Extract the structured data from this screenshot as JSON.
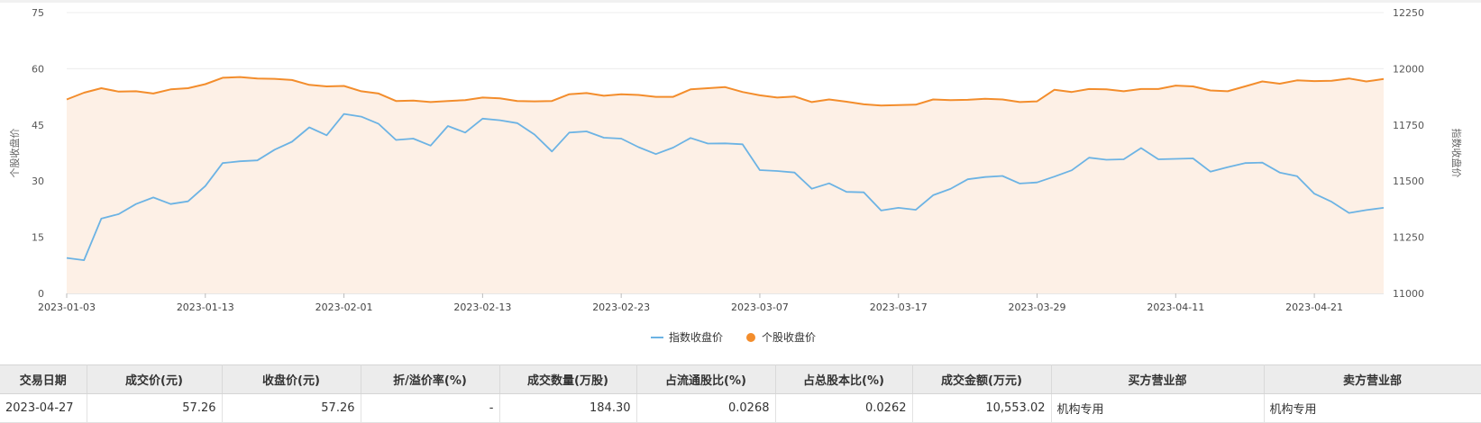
{
  "chart_data": {
    "type": "line",
    "x": [
      "2023-01-03",
      "2023-01-04",
      "2023-01-05",
      "2023-01-06",
      "2023-01-09",
      "2023-01-10",
      "2023-01-11",
      "2023-01-12",
      "2023-01-13",
      "2023-01-16",
      "2023-01-17",
      "2023-01-18",
      "2023-01-19",
      "2023-01-20",
      "2023-01-30",
      "2023-01-31",
      "2023-02-01",
      "2023-02-02",
      "2023-02-03",
      "2023-02-06",
      "2023-02-07",
      "2023-02-08",
      "2023-02-09",
      "2023-02-10",
      "2023-02-13",
      "2023-02-14",
      "2023-02-15",
      "2023-02-16",
      "2023-02-17",
      "2023-02-20",
      "2023-02-21",
      "2023-02-22",
      "2023-02-23",
      "2023-02-24",
      "2023-02-27",
      "2023-02-28",
      "2023-03-01",
      "2023-03-02",
      "2023-03-03",
      "2023-03-06",
      "2023-03-07",
      "2023-03-08",
      "2023-03-09",
      "2023-03-10",
      "2023-03-13",
      "2023-03-14",
      "2023-03-15",
      "2023-03-16",
      "2023-03-17",
      "2023-03-20",
      "2023-03-21",
      "2023-03-22",
      "2023-03-23",
      "2023-03-24",
      "2023-03-27",
      "2023-03-28",
      "2023-03-29",
      "2023-03-30",
      "2023-03-31",
      "2023-04-03",
      "2023-04-04",
      "2023-04-06",
      "2023-04-07",
      "2023-04-10",
      "2023-04-11",
      "2023-04-12",
      "2023-04-13",
      "2023-04-14",
      "2023-04-17",
      "2023-04-18",
      "2023-04-19",
      "2023-04-20",
      "2023-04-21",
      "2023-04-24",
      "2023-04-25",
      "2023-04-26",
      "2023-04-27"
    ],
    "x_ticks": [
      "2023-01-03",
      "2023-01-13",
      "2023-02-01",
      "2023-02-13",
      "2023-02-23",
      "2023-03-07",
      "2023-03-17",
      "2023-03-29",
      "2023-04-11",
      "2023-04-21"
    ],
    "series": [
      {
        "name": "指数收盘价",
        "axis": "right",
        "color": "#6cb3e4",
        "values": [
          11158,
          11148,
          11333,
          11353,
          11398,
          11427,
          11398,
          11410,
          11478,
          11580,
          11588,
          11592,
          11640,
          11675,
          11739,
          11704,
          11799,
          11787,
          11755,
          11683,
          11689,
          11658,
          11745,
          11716,
          11778,
          11771,
          11758,
          11707,
          11632,
          11716,
          11721,
          11693,
          11689,
          11651,
          11620,
          11649,
          11692,
          11667,
          11668,
          11664,
          11549,
          11545,
          11538,
          11466,
          11490,
          11452,
          11450,
          11369,
          11381,
          11372,
          11437,
          11465,
          11508,
          11518,
          11523,
          11489,
          11494,
          11520,
          11548,
          11604,
          11595,
          11597,
          11647,
          11597,
          11599,
          11601,
          11542,
          11562,
          11580,
          11582,
          11538,
          11522,
          11444,
          11408,
          11358,
          11371,
          11381
        ]
      },
      {
        "name": "个股收盘价",
        "axis": "left",
        "color": "#f38d2c",
        "values": [
          51.8,
          53.6,
          54.8,
          53.9,
          54.0,
          53.4,
          54.5,
          54.8,
          55.9,
          57.6,
          57.8,
          57.4,
          57.3,
          57.0,
          55.7,
          55.3,
          55.4,
          54.0,
          53.4,
          51.4,
          51.5,
          51.1,
          51.4,
          51.6,
          52.3,
          52.1,
          51.4,
          51.3,
          51.4,
          53.2,
          53.5,
          52.8,
          53.2,
          53.0,
          52.5,
          52.5,
          54.5,
          54.8,
          55.1,
          53.8,
          52.9,
          52.3,
          52.6,
          51.1,
          51.8,
          51.2,
          50.5,
          50.2,
          50.3,
          50.4,
          51.8,
          51.6,
          51.7,
          52.0,
          51.8,
          51.1,
          51.3,
          54.4,
          53.8,
          54.6,
          54.5,
          54.0,
          54.6,
          54.6,
          55.5,
          55.3,
          54.2,
          54.0,
          55.3,
          56.6,
          56.0,
          56.9,
          56.7,
          56.8,
          57.4,
          56.6,
          57.26
        ]
      }
    ],
    "y_left": {
      "label": "个股收盘价",
      "ticks": [
        0,
        15,
        30,
        45,
        60,
        75
      ],
      "min": 0,
      "max": 75
    },
    "y_right": {
      "label": "指数收盘价",
      "ticks": [
        11000,
        11250,
        11500,
        11750,
        12000,
        12250
      ],
      "min": 11000,
      "max": 12250
    },
    "grid": true,
    "area_fill": {
      "series": "个股收盘价",
      "color": "#fdf0e6"
    },
    "legend_position": "bottom-center"
  },
  "table": {
    "headers": [
      "交易日期",
      "成交价(元)",
      "收盘价(元)",
      "折/溢价率(%)",
      "成交数量(万股)",
      "占流通股比(%)",
      "占总股本比(%)",
      "成交金额(万元)",
      "买方营业部",
      "卖方营业部"
    ],
    "rows": [
      {
        "date": "2023-04-27",
        "deal_price": "57.26",
        "close_price": "57.26",
        "premium": "-",
        "volume": "184.30",
        "float_ratio": "0.0268",
        "total_ratio": "0.0262",
        "amount": "10,553.02",
        "buyer": "机构专用",
        "seller": "机构专用"
      }
    ]
  }
}
